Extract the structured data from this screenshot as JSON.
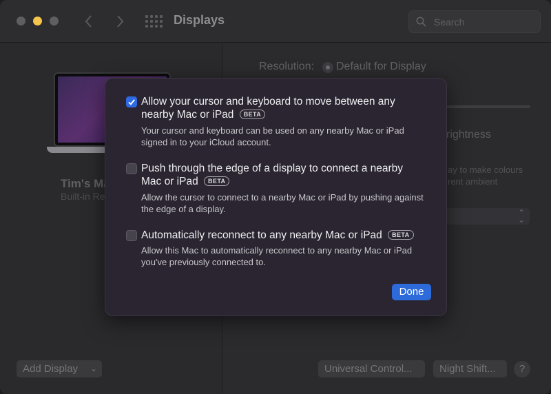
{
  "window": {
    "title": "Displays"
  },
  "search": {
    "placeholder": "Search"
  },
  "display": {
    "name": "Tim's Ma",
    "subtitle": "Built-in Re"
  },
  "settings": {
    "resolution_label": "Resolution:",
    "resolution_value": "Default for Display",
    "brightness_label": "rightness",
    "true_tone_line1": "ay to make colours",
    "true_tone_line2": "rent ambient"
  },
  "footer": {
    "add_display": "Add Display",
    "universal_control": "Universal Control...",
    "night_shift": "Night Shift...",
    "help": "?"
  },
  "sheet": {
    "options": [
      {
        "checked": true,
        "title": "Allow your cursor and keyboard to move between any nearby Mac or iPad",
        "badge": "BETA",
        "description": "Your cursor and keyboard can be used on any nearby Mac or iPad signed in to your iCloud account."
      },
      {
        "checked": false,
        "title": "Push through the edge of a display to connect a nearby Mac or iPad",
        "badge": "BETA",
        "description": "Allow the cursor to connect to a nearby Mac or iPad by pushing against the edge of a display."
      },
      {
        "checked": false,
        "title": "Automatically reconnect to any nearby Mac or iPad",
        "badge": "BETA",
        "description": "Allow this Mac to automatically reconnect to any nearby Mac or iPad you've previously connected to."
      }
    ],
    "done_label": "Done"
  },
  "colors": {
    "accent": "#2c6bd9",
    "minimize": "#f6c54c"
  }
}
